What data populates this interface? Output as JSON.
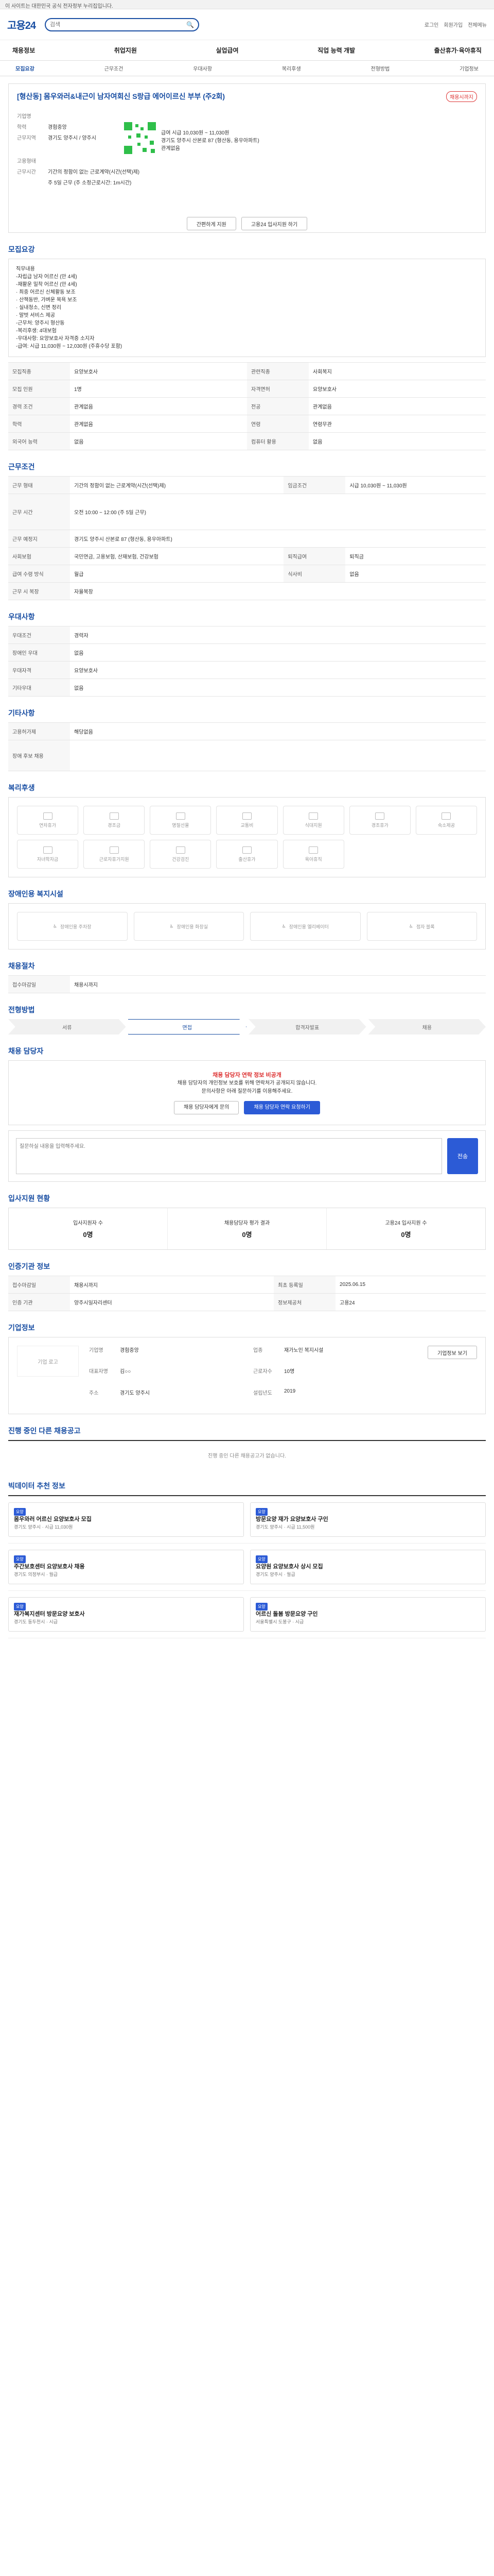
{
  "topbar": {
    "text": "이 사이트는 대한민국 공식 전자정부 누리집입니다."
  },
  "header": {
    "logo": "고용24",
    "search_placeholder": "검색",
    "links": [
      "로그인",
      "회원가입",
      "전체메뉴"
    ]
  },
  "gnb": [
    "채용정보",
    "취업지원",
    "실업급여",
    "직업 능력 개발",
    "출산휴가·육아휴직"
  ],
  "tabs": [
    {
      "label": "모집요강",
      "on": true
    },
    {
      "label": "근무조건",
      "on": false
    },
    {
      "label": "우대사항",
      "on": false
    },
    {
      "label": "복리후생",
      "on": false
    },
    {
      "label": "전형방법",
      "on": false
    },
    {
      "label": "기업정보",
      "on": false
    }
  ],
  "job": {
    "title": "[형산동] 몸우와러&내근이 남자여회신 S랑급 에어이르신 부부 (주2회)",
    "badge": "채용시까지",
    "company_label": "기업명",
    "company": "경험중앙",
    "address_label": "근무지역",
    "address": "경기도 양주시 / 양주시",
    "employment_label": "고용형태",
    "employment": "기간의 정함이 없는 근로계약(시간(선택)제)",
    "hours_label": "근무시간",
    "hours": "주 5일 근무 (주 소정근로시간: 1m시간)",
    "pay_label": "급여",
    "pay": "시급 10,030원 ~ 11,030원",
    "edu_label": "학력",
    "edu": "관계없음",
    "location_line": "경기도 양주시 산본로 87 (형산동, 용우아파트)",
    "apply_button": "간편하게 지원",
    "share_button": "고용24 입사지원 하기"
  },
  "sections": {
    "recruit": "모집요강",
    "conditions": "근무조건",
    "prefer": "우대사항",
    "etc": "기타사항",
    "welfare": "복리후생",
    "disability": "장애인용 복지시설",
    "process": "채용절차",
    "selection": "전형방법",
    "contact": "채용 담당자",
    "apply_status": "입사지원 현황",
    "manager_info": "인증기관 정보",
    "company_info": "기업정보",
    "other_jobs": "진행 중인 다른 채용공고",
    "recommend": "빅데이터 추천 정보"
  },
  "recruit_desc": [
    "직무내용",
    "-자립급 남자 어르신 (만 4세)",
    "-재활운 밀착 어르신 (만 4세)",
    "  · 최중 어르신 신체활동 보조",
    "  · 산책동반, 가벼운 목욕 보조",
    "  · 실내청소, 신변 정리",
    "  · 말벗 서비스 제공",
    "-근무처: 양주시 형산동",
    "-복리후생: 4대보험",
    "-우대사항: 요양보호사 자격증 소지자",
    "-급여: 시급 11,030원 ~ 12,030원 (주휴수당 포함)"
  ],
  "recruit_table": [
    [
      "모집직종",
      "요양보호사",
      "관련직종",
      "사회복지"
    ],
    [
      "모집 인원",
      "1명",
      "자격면허",
      "요양보호사"
    ],
    [
      "경력 조건",
      "관계없음",
      "전공",
      "관계없음"
    ],
    [
      "학력",
      "관계없음",
      "연령",
      "연령무관"
    ],
    [
      "외국어 능력",
      "없음",
      "컴퓨터 활용",
      "없음"
    ]
  ],
  "conditions_table": [
    [
      "근무 형태",
      "기간의 정함이 없는 근로계약(시간(선택)제)",
      "임금조건",
      "시급 10,030원 ~ 11,030원"
    ],
    [
      "근무 시간",
      "오전 10:00 ~ 12:00 (주 5일 근무)",
      "",
      ""
    ],
    [
      "근무 예정지",
      "경기도 양주시 산본로 87 (형산동, 용우아파트)",
      "",
      ""
    ],
    [
      "사회보험",
      "국민연금, 고용보험, 산재보험, 건강보험",
      "퇴직급여",
      "퇴직금"
    ],
    [
      "급여 수령 방식",
      "월급",
      "식사비",
      "없음"
    ],
    [
      "근무 시 복장",
      "자율복장",
      "",
      ""
    ]
  ],
  "prefer_table": [
    [
      "우대조건",
      "경력자"
    ],
    [
      "장애인 우대",
      "없음"
    ],
    [
      "우대자격",
      "요양보호사"
    ],
    [
      "기타우대",
      "없음"
    ]
  ],
  "etc_table": [
    [
      "고용허가제",
      "해당없음"
    ],
    [
      "장애 후보 채용"
    ]
  ],
  "welfare_items": [
    "연차휴가",
    "경조금",
    "명절선물",
    "교통비",
    "식대지원",
    "경조휴가",
    "숙소제공",
    "자녀학자금",
    "근로자휴가지원",
    "건강검진",
    "출산휴가",
    "육아휴직"
  ],
  "disability_items": [
    "장애인용 주차장",
    "장애인용 화장실",
    "장애인용 엘리베이터",
    "점자 블록"
  ],
  "steps": [
    "서류",
    "면접",
    "합격자발표",
    "채용"
  ],
  "contact": {
    "red": "채용 담당자 연락 정보 비공개",
    "line1": "채용 담당자의 개인정보 보호를 위해 연락처가 공개되지 않습니다.",
    "line2": "문의사항은 아래 질문하기를 이용해주세요.",
    "btn1": "채용 담당자에게 문의",
    "btn2": "채용 담당자 연락 요청하기"
  },
  "qa": {
    "placeholder": "질문하실 내용을 입력해주세요.",
    "send": "전송"
  },
  "stats": [
    {
      "label": "입사지원자 수",
      "value": "0명"
    },
    {
      "label": "채용담당자 평가 결과",
      "value": "0명"
    },
    {
      "label": "고용24 입사지원 수",
      "value": "0명"
    }
  ],
  "manager_table": [
    [
      "접수마감일",
      "채용시까지",
      "최초 등록일",
      "2025.06.15"
    ],
    [
      "인증 기관",
      "양주시일자리센터",
      "정보제공처",
      "고용24"
    ]
  ],
  "company": {
    "logo_text": "기업 로고",
    "fields": [
      [
        "기업명",
        "경험중앙"
      ],
      [
        "업종",
        "재가노인 복지시설"
      ],
      [
        "대표자명",
        "김○○"
      ],
      [
        "근로자수",
        "10명"
      ],
      [
        "주소",
        "경기도 양주시"
      ],
      [
        "설립년도",
        "2019"
      ]
    ],
    "button": "기업정보 보기"
  },
  "other_jobs_empty": "진행 중인 다른 채용공고가 없습니다.",
  "recommend_items": [
    {
      "tag": "요양",
      "title": "몸우와러 어르신 요양보호사 모집",
      "meta": "경기도 양주시 · 시급 11,030원"
    },
    {
      "tag": "요양",
      "title": "방문요양 재가 요양보호사 구인",
      "meta": "경기도 양주시 · 시급 11,500원"
    },
    {
      "tag": "요양",
      "title": "주간보호센터 요양보호사 채용",
      "meta": "경기도 의정부시 · 월급"
    },
    {
      "tag": "요양",
      "title": "요양원 요양보호사 상시 모집",
      "meta": "경기도 양주시 · 월급"
    },
    {
      "tag": "요양",
      "title": "재가복지센터 방문요양 보호사",
      "meta": "경기도 동두천시 · 시급"
    },
    {
      "tag": "요양",
      "title": "어르신 돌봄 방문요양 구인",
      "meta": "서울특별시 도봉구 · 시급"
    }
  ]
}
